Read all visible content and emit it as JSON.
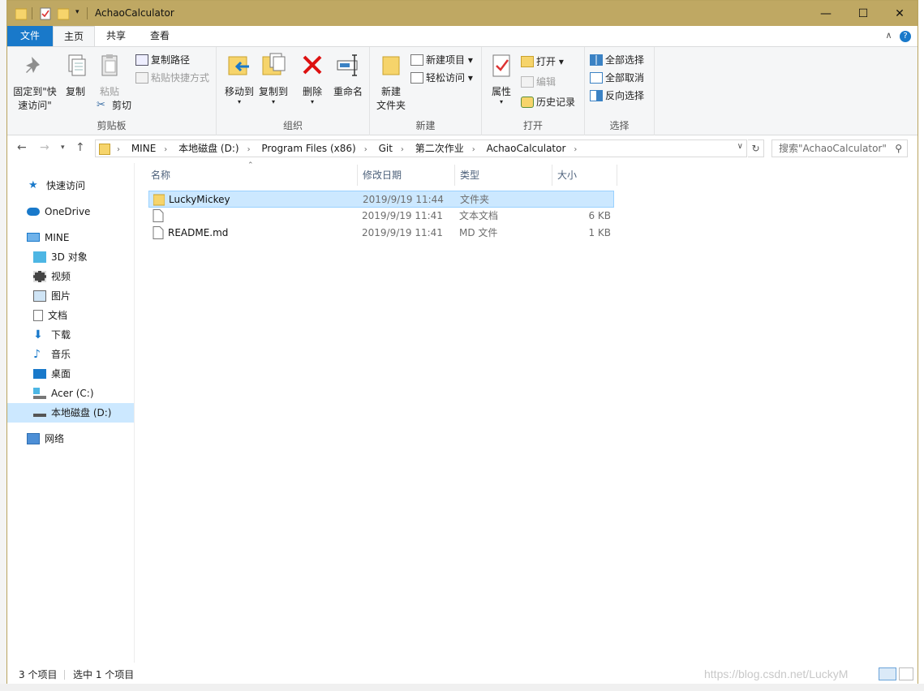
{
  "window": {
    "title": "AchaoCalculator"
  },
  "ribbon_tabs": [
    "文件",
    "主页",
    "共享",
    "查看"
  ],
  "clipboard": {
    "pin_label_1": "固定到\"快",
    "pin_label_2": "速访问\"",
    "copy": "复制",
    "paste": "粘贴",
    "copy_path": "复制路径",
    "paste_shortcut": "粘贴快捷方式",
    "cut": "剪切",
    "group": "剪贴板"
  },
  "organize": {
    "move_to": "移动到",
    "copy_to": "复制到",
    "delete": "删除",
    "rename": "重命名",
    "group": "组织"
  },
  "new": {
    "new_folder_1": "新建",
    "new_folder_2": "文件夹",
    "new_item": "新建项目",
    "easy_access": "轻松访问",
    "group": "新建"
  },
  "open": {
    "properties": "属性",
    "open": "打开",
    "edit": "编辑",
    "history": "历史记录",
    "group": "打开"
  },
  "select": {
    "select_all": "全部选择",
    "select_none": "全部取消",
    "invert": "反向选择",
    "group": "选择"
  },
  "breadcrumb": [
    "MINE",
    "本地磁盘 (D:)",
    "Program Files (x86)",
    "Git",
    "第二次作业",
    "AchaoCalculator"
  ],
  "search": {
    "placeholder": "搜索\"AchaoCalculator\""
  },
  "nav": {
    "quick_access": "快速访问",
    "onedrive": "OneDrive",
    "this_pc": "MINE",
    "objects3d": "3D 对象",
    "videos": "视频",
    "pictures": "图片",
    "documents": "文档",
    "downloads": "下载",
    "music": "音乐",
    "desktop": "桌面",
    "drive_c": "Acer (C:)",
    "drive_d": "本地磁盘 (D:)",
    "network": "网络"
  },
  "columns": {
    "name": "名称",
    "date": "修改日期",
    "type": "类型",
    "size": "大小"
  },
  "files": [
    {
      "name": "LuckyMickey",
      "date": "2019/9/19 11:44",
      "type": "文件夹",
      "size": ""
    },
    {
      "name": "",
      "date": "2019/9/19 11:41",
      "type": "文本文档",
      "size": "6 KB"
    },
    {
      "name": "README.md",
      "date": "2019/9/19 11:41",
      "type": "MD 文件",
      "size": "1 KB"
    }
  ],
  "status": {
    "item_count": "3 个项目",
    "selected": "选中 1 个项目"
  },
  "watermark": "https://blog.csdn.net/LuckyM"
}
